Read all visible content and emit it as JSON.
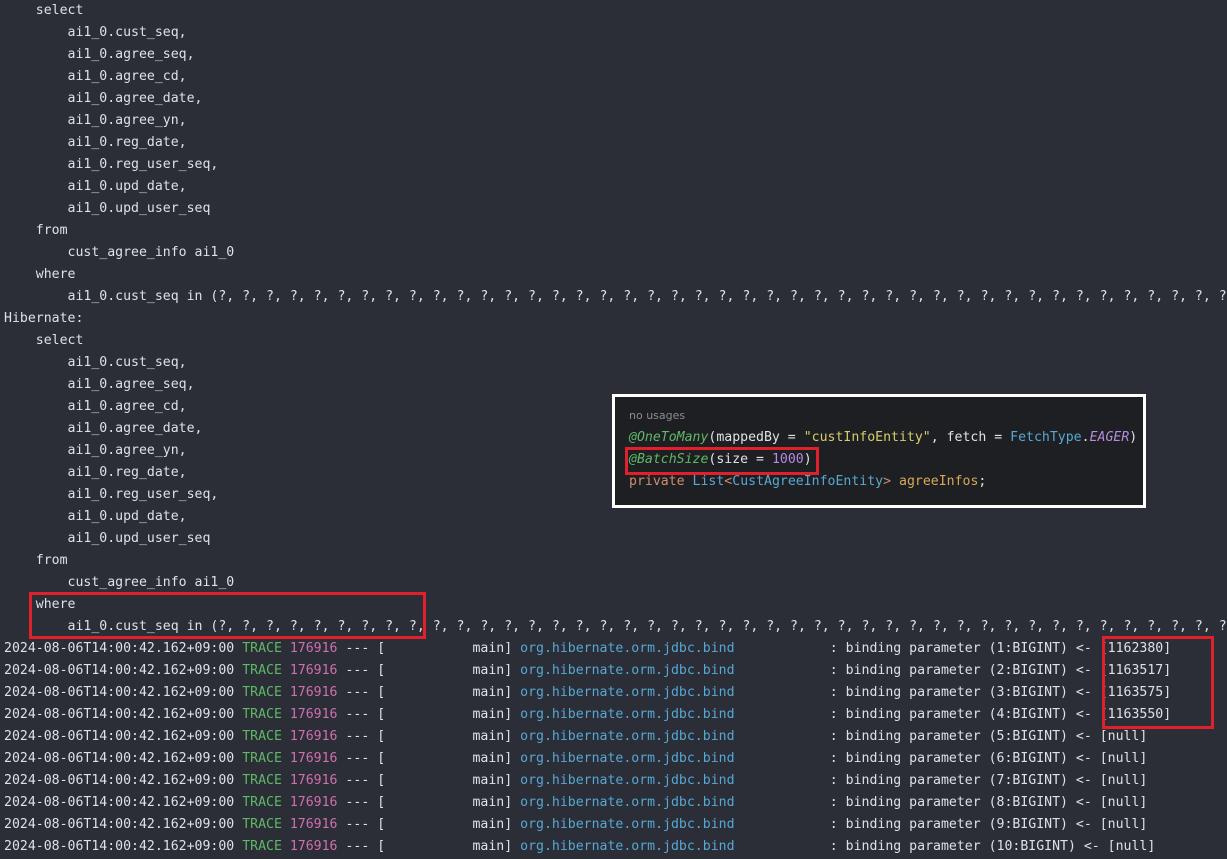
{
  "sql_before": [
    "    select",
    "        ai1_0.cust_seq,",
    "        ai1_0.agree_seq,",
    "        ai1_0.agree_cd,",
    "        ai1_0.agree_date,",
    "        ai1_0.agree_yn,",
    "        ai1_0.reg_date,",
    "        ai1_0.reg_user_seq,",
    "        ai1_0.upd_date,",
    "        ai1_0.upd_user_seq",
    "    from",
    "        cust_agree_info ai1_0",
    "    where",
    "        ai1_0.cust_seq in (?, ?, ?, ?, ?, ?, ?, ?, ?, ?, ?, ?, ?, ?, ?, ?, ?, ?, ?, ?, ?, ?, ?, ?, ?, ?, ?, ?, ?, ?, ?, ?, ?, ?, ?, ?, ?, ?, ?, ?, ?, ?, ?, ?, ?, ?,",
    "Hibernate:",
    "    select",
    "        ai1_0.cust_seq,",
    "        ai1_0.agree_seq,",
    "        ai1_0.agree_cd,",
    "        ai1_0.agree_date,",
    "        ai1_0.agree_yn,",
    "        ai1_0.reg_date,",
    "        ai1_0.reg_user_seq,",
    "        ai1_0.upd_date,",
    "        ai1_0.upd_user_seq",
    "    from",
    "        cust_agree_info ai1_0",
    "    where",
    "        ai1_0.cust_seq in (?, ?, ?, ?, ?, ?, ?, ?, ?, ?, ?, ?, ?, ?, ?, ?, ?, ?, ?, ?, ?, ?, ?, ?, ?, ?, ?, ?, ?, ?, ?, ?, ?, ?, ?, ?, ?, ?, ?, ?, ?, ?, ?, ?, ?, ?,"
  ],
  "log_lines": [
    {
      "ts": "2024-08-06T14:00:42.162+09:00",
      "level": "TRACE",
      "pid": "176916",
      "thread": "--- [           main]",
      "logger": "org.hibernate.orm.jdbc.bind",
      "msg": "            : binding parameter (1:BIGINT) <- [1162380]"
    },
    {
      "ts": "2024-08-06T14:00:42.162+09:00",
      "level": "TRACE",
      "pid": "176916",
      "thread": "--- [           main]",
      "logger": "org.hibernate.orm.jdbc.bind",
      "msg": "            : binding parameter (2:BIGINT) <- [1163517]"
    },
    {
      "ts": "2024-08-06T14:00:42.162+09:00",
      "level": "TRACE",
      "pid": "176916",
      "thread": "--- [           main]",
      "logger": "org.hibernate.orm.jdbc.bind",
      "msg": "            : binding parameter (3:BIGINT) <- [1163575]"
    },
    {
      "ts": "2024-08-06T14:00:42.162+09:00",
      "level": "TRACE",
      "pid": "176916",
      "thread": "--- [           main]",
      "logger": "org.hibernate.orm.jdbc.bind",
      "msg": "            : binding parameter (4:BIGINT) <- [1163550]"
    },
    {
      "ts": "2024-08-06T14:00:42.162+09:00",
      "level": "TRACE",
      "pid": "176916",
      "thread": "--- [           main]",
      "logger": "org.hibernate.orm.jdbc.bind",
      "msg": "            : binding parameter (5:BIGINT) <- [null]"
    },
    {
      "ts": "2024-08-06T14:00:42.162+09:00",
      "level": "TRACE",
      "pid": "176916",
      "thread": "--- [           main]",
      "logger": "org.hibernate.orm.jdbc.bind",
      "msg": "            : binding parameter (6:BIGINT) <- [null]"
    },
    {
      "ts": "2024-08-06T14:00:42.162+09:00",
      "level": "TRACE",
      "pid": "176916",
      "thread": "--- [           main]",
      "logger": "org.hibernate.orm.jdbc.bind",
      "msg": "            : binding parameter (7:BIGINT) <- [null]"
    },
    {
      "ts": "2024-08-06T14:00:42.162+09:00",
      "level": "TRACE",
      "pid": "176916",
      "thread": "--- [           main]",
      "logger": "org.hibernate.orm.jdbc.bind",
      "msg": "            : binding parameter (8:BIGINT) <- [null]"
    },
    {
      "ts": "2024-08-06T14:00:42.162+09:00",
      "level": "TRACE",
      "pid": "176916",
      "thread": "--- [           main]",
      "logger": "org.hibernate.orm.jdbc.bind",
      "msg": "            : binding parameter (9:BIGINT) <- [null]"
    },
    {
      "ts": "2024-08-06T14:00:42.162+09:00",
      "level": "TRACE",
      "pid": "176916",
      "thread": "--- [           main]",
      "logger": "org.hibernate.orm.jdbc.bind",
      "msg": "            : binding parameter (10:BIGINT) <- [null]"
    }
  ],
  "code_popup": {
    "usage_hint": "no usages",
    "annotation1": "@OneToMany",
    "annotation1_open": "(mappedBy = ",
    "annotation1_string": "\"custInfoEntity\"",
    "annotation1_mid": ", fetch = ",
    "annotation1_class": "FetchType",
    "annotation1_dot": ".",
    "annotation1_const": "EAGER",
    "annotation1_close": ")",
    "annotation2": "@BatchSize",
    "annotation2_open": "(size = ",
    "annotation2_value": "1000",
    "annotation2_close": ")",
    "field_keyword": "private ",
    "field_type": "List",
    "field_generic_open": "<",
    "field_generic_type": "CustAgreeInfoEntity",
    "field_generic_close": "> ",
    "field_name": "agreeInfos",
    "field_end": ";"
  },
  "colors": {
    "background": "#2b2d37",
    "highlight_box": "#e0202a",
    "popup_border": "#ffffff"
  }
}
